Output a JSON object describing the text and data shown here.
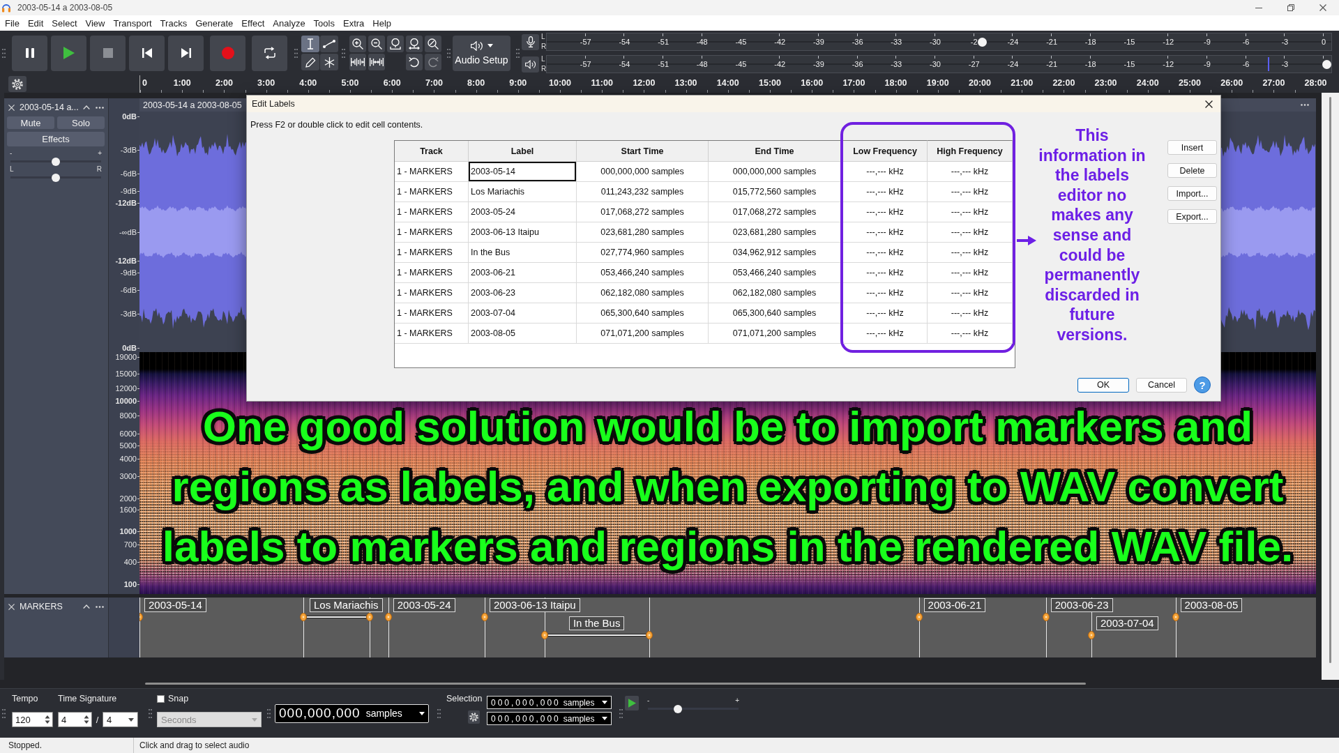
{
  "window": {
    "title": "2003-05-14 a 2003-08-05"
  },
  "menu_bar": [
    "File",
    "Edit",
    "Select",
    "View",
    "Transport",
    "Tracks",
    "Generate",
    "Effect",
    "Analyze",
    "Tools",
    "Extra",
    "Help"
  ],
  "tools": [
    {
      "kind": "select",
      "selected": true
    },
    {
      "kind": "envelope",
      "selected": false
    },
    {
      "kind": "draw",
      "selected": false
    },
    {
      "kind": "multi",
      "selected": false
    }
  ],
  "history": [
    {
      "kind": "undo",
      "disabled": false
    },
    {
      "kind": "redo",
      "disabled": true
    }
  ],
  "audio_setup": {
    "label": "Audio Setup"
  },
  "meters": [
    {
      "kind": "recording",
      "channels": [
        "L",
        "R"
      ],
      "scale": [
        "-57",
        "-54",
        "-51",
        "-48",
        "-45",
        "-42",
        "-39",
        "-36",
        "-33",
        "-30",
        "-2",
        "-24",
        "-21",
        "-18",
        "-15",
        "-12",
        "-9",
        "-6",
        "-3",
        "0"
      ],
      "slider": {
        "level": 0.555
      }
    },
    {
      "kind": "playback",
      "channels": [
        "L",
        "R"
      ],
      "scale": [
        "-57",
        "-54",
        "-51",
        "-48",
        "-45",
        "-42",
        "-39",
        "-36",
        "-33",
        "-30",
        "-27",
        "-24",
        "-21",
        "-18",
        "-15",
        "-12",
        "-9",
        "-6",
        "-3"
      ],
      "slider": {
        "level": 0.994
      },
      "peak_hold": {
        "level": 0.92
      }
    }
  ],
  "timeline": {
    "ticks": [
      "0",
      "1:00",
      "2:00",
      "3:00",
      "4:00",
      "5:00",
      "6:00",
      "7:00",
      "8:00",
      "9:00",
      "10:00",
      "11:00",
      "12:00",
      "13:00",
      "14:00",
      "15:00",
      "16:00",
      "17:00",
      "18:00",
      "19:00",
      "20:00",
      "21:00",
      "22:00",
      "23:00",
      "24:00",
      "25:00",
      "26:00",
      "27:00",
      "28:00"
    ]
  },
  "tracks": [
    {
      "kind": "audio",
      "name": "2003-05-14 a...",
      "mute": "Mute",
      "solo": "Solo",
      "effects": "Effects",
      "gain": {
        "minus": "-",
        "plus": "+",
        "level": 0.5
      },
      "pan": {
        "left": "L",
        "right": "R",
        "level": 0.5
      },
      "clip_title": "2003-05-14 a 2003-08-05",
      "db_scale": [
        {
          "label": "0dB",
          "major": true
        },
        {
          "label": "-3dB",
          "major": false
        },
        {
          "label": "-6dB",
          "major": false
        },
        {
          "label": "-9dB",
          "major": false
        },
        {
          "label": "-12dB",
          "major": true
        },
        {
          "label": "-∞dB",
          "major": false
        },
        {
          "label": "-12dB",
          "major": true
        },
        {
          "label": "-9dB",
          "major": false
        },
        {
          "label": "-6dB",
          "major": false
        },
        {
          "label": "-3dB",
          "major": false
        },
        {
          "label": "0dB",
          "major": true
        }
      ],
      "freq_scale": [
        {
          "label": "19000",
          "major": false
        },
        {
          "label": "15000",
          "major": false
        },
        {
          "label": "12000",
          "major": false
        },
        {
          "label": "10000",
          "major": true
        },
        {
          "label": "8000",
          "major": false
        },
        {
          "label": "6000",
          "major": false
        },
        {
          "label": "5000",
          "major": false
        },
        {
          "label": "4000",
          "major": false
        },
        {
          "label": "3000",
          "major": false
        },
        {
          "label": "2000",
          "major": false
        },
        {
          "label": "1600",
          "major": false
        },
        {
          "label": "1000",
          "major": true
        },
        {
          "label": "700",
          "major": false
        },
        {
          "label": "400",
          "major": false
        },
        {
          "label": "100",
          "major": true
        }
      ]
    },
    {
      "kind": "label",
      "name": "MARKERS",
      "labels": [
        "2003-05-14",
        "Los Mariachis",
        "2003-05-24",
        "2003-06-13 Itaipu",
        "In the Bus",
        "2003-06-21",
        "2003-06-23",
        "2003-07-04",
        "2003-08-05"
      ]
    }
  ],
  "dialog": {
    "title": "Edit Labels",
    "instruction": "Press F2 or double click to edit cell contents.",
    "columns": [
      "Track",
      "Label",
      "Start Time",
      "End Time",
      "Low Frequency",
      "High Frequency"
    ],
    "rows": [
      {
        "cells": [
          "1 - MARKERS",
          "2003-05-14",
          "000,000,000 samples",
          "000,000,000 samples",
          "---,--- kHz",
          "---,--- kHz"
        ],
        "selected": true
      },
      {
        "cells": [
          "1 - MARKERS",
          "Los Mariachis",
          "011,243,232 samples",
          "015,772,560 samples",
          "---,--- kHz",
          "---,--- kHz"
        ],
        "selected": false
      },
      {
        "cells": [
          "1 - MARKERS",
          "2003-05-24",
          "017,068,272 samples",
          "017,068,272 samples",
          "---,--- kHz",
          "---,--- kHz"
        ],
        "selected": false
      },
      {
        "cells": [
          "1 - MARKERS",
          "2003-06-13 Itaipu",
          "023,681,280 samples",
          "023,681,280 samples",
          "---,--- kHz",
          "---,--- kHz"
        ],
        "selected": false
      },
      {
        "cells": [
          "1 - MARKERS",
          "In the Bus",
          "027,774,960 samples",
          "034,962,912 samples",
          "---,--- kHz",
          "---,--- kHz"
        ],
        "selected": false
      },
      {
        "cells": [
          "1 - MARKERS",
          "2003-06-21",
          "053,466,240 samples",
          "053,466,240 samples",
          "---,--- kHz",
          "---,--- kHz"
        ],
        "selected": false
      },
      {
        "cells": [
          "1 - MARKERS",
          "2003-06-23",
          "062,182,080 samples",
          "062,182,080 samples",
          "---,--- kHz",
          "---,--- kHz"
        ],
        "selected": false
      },
      {
        "cells": [
          "1 - MARKERS",
          "2003-07-04",
          "065,300,640 samples",
          "065,300,640 samples",
          "---,--- kHz",
          "---,--- kHz"
        ],
        "selected": false
      },
      {
        "cells": [
          "1 - MARKERS",
          "2003-08-05",
          "071,071,200 samples",
          "071,071,200 samples",
          "---,--- kHz",
          "---,--- kHz"
        ],
        "selected": false
      }
    ],
    "side_buttons": [
      "Insert",
      "Delete",
      "Import...",
      "Export..."
    ],
    "footer_buttons": [
      {
        "label": "OK",
        "default": true
      },
      {
        "label": "Cancel",
        "default": false
      }
    ],
    "help": "?"
  },
  "annotations": {
    "note": [
      "This",
      "information in",
      "the labels",
      "editor no",
      "makes any",
      "sense and",
      "could be",
      "permanently",
      "discarded in",
      "future",
      "versions."
    ],
    "caption": [
      "One good solution would be to import markers and",
      "regions as labels, and when exporting to WAV convert",
      "labels to markers and regions in the rendered WAV file."
    ]
  },
  "bottom_toolbar": {
    "tempo": {
      "label": "Tempo",
      "value": "120"
    },
    "time_signature": {
      "label": "Time Signature",
      "upper": "4",
      "separator": "/",
      "lower": "4"
    },
    "snap": {
      "label": "Snap",
      "checked": false,
      "unit": "Seconds",
      "disabled": true
    },
    "time_display": {
      "value": "000,000,000",
      "unit": "samples"
    },
    "selection": {
      "label": "Selection",
      "fields": [
        {
          "value": "000,000,000",
          "unit": "samples"
        },
        {
          "value": "000,000,000",
          "unit": "samples"
        }
      ]
    },
    "play_at_speed": {
      "minus": "-",
      "plus": "+",
      "level": 0.33
    }
  },
  "status_bar": [
    "Stopped.",
    "Click and drag to select audio"
  ]
}
